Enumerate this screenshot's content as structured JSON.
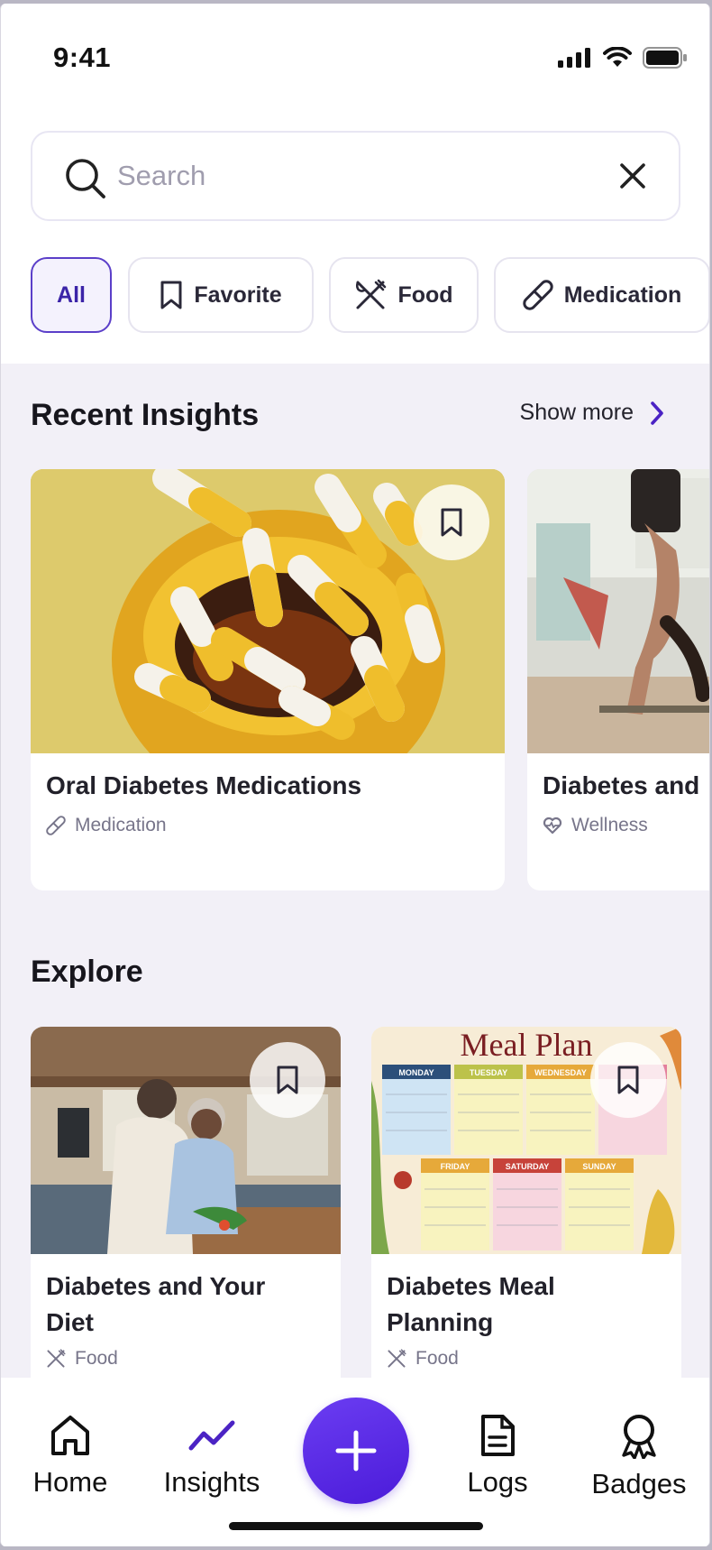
{
  "status_bar": {
    "time": "9:41"
  },
  "search": {
    "placeholder": "Search",
    "value": ""
  },
  "filters": [
    {
      "label": "All",
      "icon": "none",
      "active": true
    },
    {
      "label": "Favorite",
      "icon": "bookmark-icon",
      "active": false
    },
    {
      "label": "Food",
      "icon": "utensils-icon",
      "active": false
    },
    {
      "label": "Medication",
      "icon": "pill-icon",
      "active": false
    }
  ],
  "recent": {
    "title": "Recent Insights",
    "show_more": "Show more",
    "cards": [
      {
        "title": "Oral Diabetes Medications",
        "tag": "Medication",
        "tag_icon": "pill-icon",
        "image": "yellow pills in jar"
      },
      {
        "title": "Diabetes and",
        "tag": "Wellness",
        "tag_icon": "heart-icon",
        "image": "handstand exercise"
      }
    ]
  },
  "explore": {
    "title": "Explore",
    "cards": [
      {
        "title_line1": "Diabetes and Your",
        "title_line2": "Diet",
        "tag": "Food",
        "tag_icon": "utensils-icon",
        "image": "couple cooking"
      },
      {
        "title_line1": "Diabetes Meal",
        "title_line2": "Planning",
        "tag": "Food",
        "tag_icon": "utensils-icon",
        "image": "meal plan calendar",
        "image_text": {
          "heading": "Meal Plan",
          "days": [
            "MONDAY",
            "TUESDAY",
            "WEDNESDAY",
            "FRIDAY",
            "SATURDAY",
            "SUNDAY"
          ]
        }
      }
    ]
  },
  "tabbar": {
    "tabs": [
      {
        "label": "Home",
        "icon": "home-icon",
        "active": false
      },
      {
        "label": "Insights",
        "icon": "trend-icon",
        "active": true
      },
      {
        "label": "Logs",
        "icon": "document-icon",
        "active": false
      },
      {
        "label": "Badges",
        "icon": "badge-icon",
        "active": false
      }
    ],
    "fab_icon": "plus-icon"
  },
  "colors": {
    "accent": "#4b23c4",
    "background": "#f2f0f7",
    "chip_active_border": "#5b3fc9"
  }
}
